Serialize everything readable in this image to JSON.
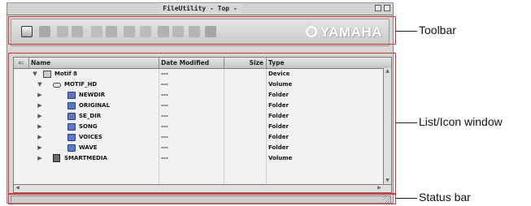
{
  "window": {
    "title": "FileUtility - Top -"
  },
  "toolbar": {
    "brand": "YAMAHA",
    "icons": [
      "view-mode-icon",
      "list-view-icon",
      "eject-icon",
      "copy-icon",
      "new-folder-icon",
      "format-icon",
      "info-icon",
      "delete-icon",
      "rename-icon",
      "paste-icon",
      "duplicate-icon",
      "sort-icon"
    ]
  },
  "list": {
    "columns": {
      "name": "Name",
      "date": "Date Modified",
      "size": "Size",
      "type": "Type"
    },
    "rows": [
      {
        "name": "Motif 8",
        "date": "---",
        "type": "Device",
        "expanded": true,
        "level": 0,
        "icon": "device-icon"
      },
      {
        "name": "MOTIF_HD",
        "date": "---",
        "type": "Volume",
        "expanded": true,
        "level": 1,
        "icon": "hard-disk-icon"
      },
      {
        "name": "NEWDIR",
        "date": "---",
        "type": "Folder",
        "expanded": false,
        "level": 2,
        "icon": "folder-icon"
      },
      {
        "name": "ORIGINAL",
        "date": "---",
        "type": "Folder",
        "expanded": false,
        "level": 2,
        "icon": "folder-icon"
      },
      {
        "name": "SE_DIR",
        "date": "---",
        "type": "Folder",
        "expanded": false,
        "level": 2,
        "icon": "folder-icon"
      },
      {
        "name": "SONG",
        "date": "---",
        "type": "Folder",
        "expanded": false,
        "level": 2,
        "icon": "folder-icon"
      },
      {
        "name": "VOICES",
        "date": "---",
        "type": "Folder",
        "expanded": false,
        "level": 2,
        "icon": "folder-icon"
      },
      {
        "name": "WAVE",
        "date": "---",
        "type": "Folder",
        "expanded": false,
        "level": 2,
        "icon": "folder-icon"
      },
      {
        "name": "SMARTMEDIA",
        "date": "---",
        "type": "Volume",
        "expanded": false,
        "level": 1,
        "icon": "smartmedia-icon"
      }
    ]
  },
  "annotations": {
    "toolbar": "Toolbar",
    "list": "List/Icon window",
    "status": "Status bar"
  },
  "colors": {
    "callout_box": "#e03030",
    "folder": "#5a78c8",
    "window_bg": "#d6d6d6"
  }
}
